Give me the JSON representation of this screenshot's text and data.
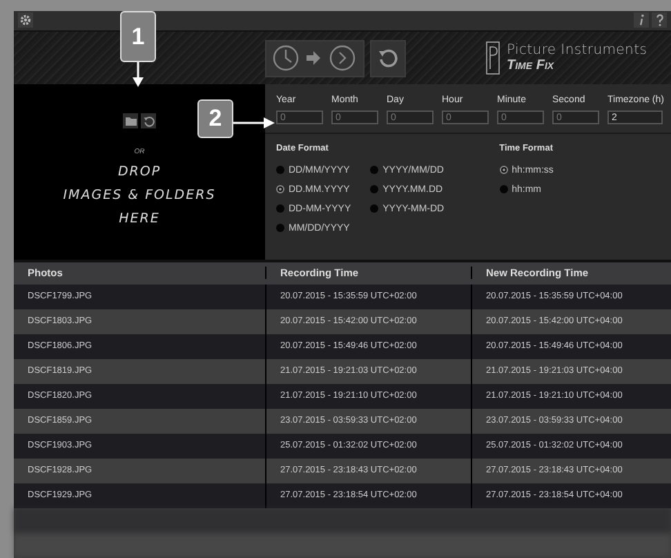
{
  "callouts": [
    "1",
    "2"
  ],
  "logo": {
    "brand": "Picture Instruments",
    "product": "Time Fix"
  },
  "drop_zone": {
    "or": "OR",
    "lines": [
      "DROP",
      "IMAGES & FOLDERS",
      "HERE"
    ]
  },
  "offset_fields": [
    {
      "label": "Year",
      "placeholder": "0"
    },
    {
      "label": "Month",
      "placeholder": "0"
    },
    {
      "label": "Day",
      "placeholder": "0"
    },
    {
      "label": "Hour",
      "placeholder": "0"
    },
    {
      "label": "Minute",
      "placeholder": "0"
    },
    {
      "label": "Second",
      "placeholder": "0"
    },
    {
      "label": "Timezone (h)",
      "value": "2"
    }
  ],
  "date_format": {
    "title": "Date Format",
    "options": [
      {
        "label": "DD/MM/YYYY",
        "selected": false
      },
      {
        "label": "DD.MM.YYYY",
        "selected": true
      },
      {
        "label": "DD-MM-YYYY",
        "selected": false
      },
      {
        "label": "MM/DD/YYYY",
        "selected": false
      },
      {
        "label": "YYYY/MM/DD",
        "selected": false
      },
      {
        "label": "YYYY.MM.DD",
        "selected": false
      },
      {
        "label": "YYYY-MM-DD",
        "selected": false
      }
    ]
  },
  "time_format": {
    "title": "Time Format",
    "options": [
      {
        "label": "hh:mm:ss",
        "selected": true
      },
      {
        "label": "hh:mm",
        "selected": false
      }
    ]
  },
  "table": {
    "columns": [
      "Photos",
      "Recording Time",
      "New Recording Time"
    ],
    "rows": [
      [
        "DSCF1799.JPG",
        "20.07.2015 - 15:35:59  UTC+02:00",
        "20.07.2015 - 15:35:59  UTC+04:00"
      ],
      [
        "DSCF1803.JPG",
        "20.07.2015 - 15:42:00  UTC+02:00",
        "20.07.2015 - 15:42:00  UTC+04:00"
      ],
      [
        "DSCF1806.JPG",
        "20.07.2015 - 15:49:46  UTC+02:00",
        "20.07.2015 - 15:49:46  UTC+04:00"
      ],
      [
        "DSCF1819.JPG",
        "21.07.2015 - 19:21:03  UTC+02:00",
        "21.07.2015 - 19:21:03  UTC+04:00"
      ],
      [
        "DSCF1820.JPG",
        "21.07.2015 - 19:21:10  UTC+02:00",
        "21.07.2015 - 19:21:10  UTC+04:00"
      ],
      [
        "DSCF1859.JPG",
        "23.07.2015 - 03:59:33  UTC+02:00",
        "23.07.2015 - 03:59:33  UTC+04:00"
      ],
      [
        "DSCF1903.JPG",
        "25.07.2015 - 01:32:02  UTC+02:00",
        "25.07.2015 - 01:32:02  UTC+04:00"
      ],
      [
        "DSCF1928.JPG",
        "27.07.2015 - 23:18:43  UTC+02:00",
        "27.07.2015 - 23:18:43  UTC+04:00"
      ],
      [
        "DSCF1929.JPG",
        "27.07.2015 - 23:18:54  UTC+02:00",
        "27.07.2015 - 23:18:54  UTC+04:00"
      ]
    ]
  }
}
